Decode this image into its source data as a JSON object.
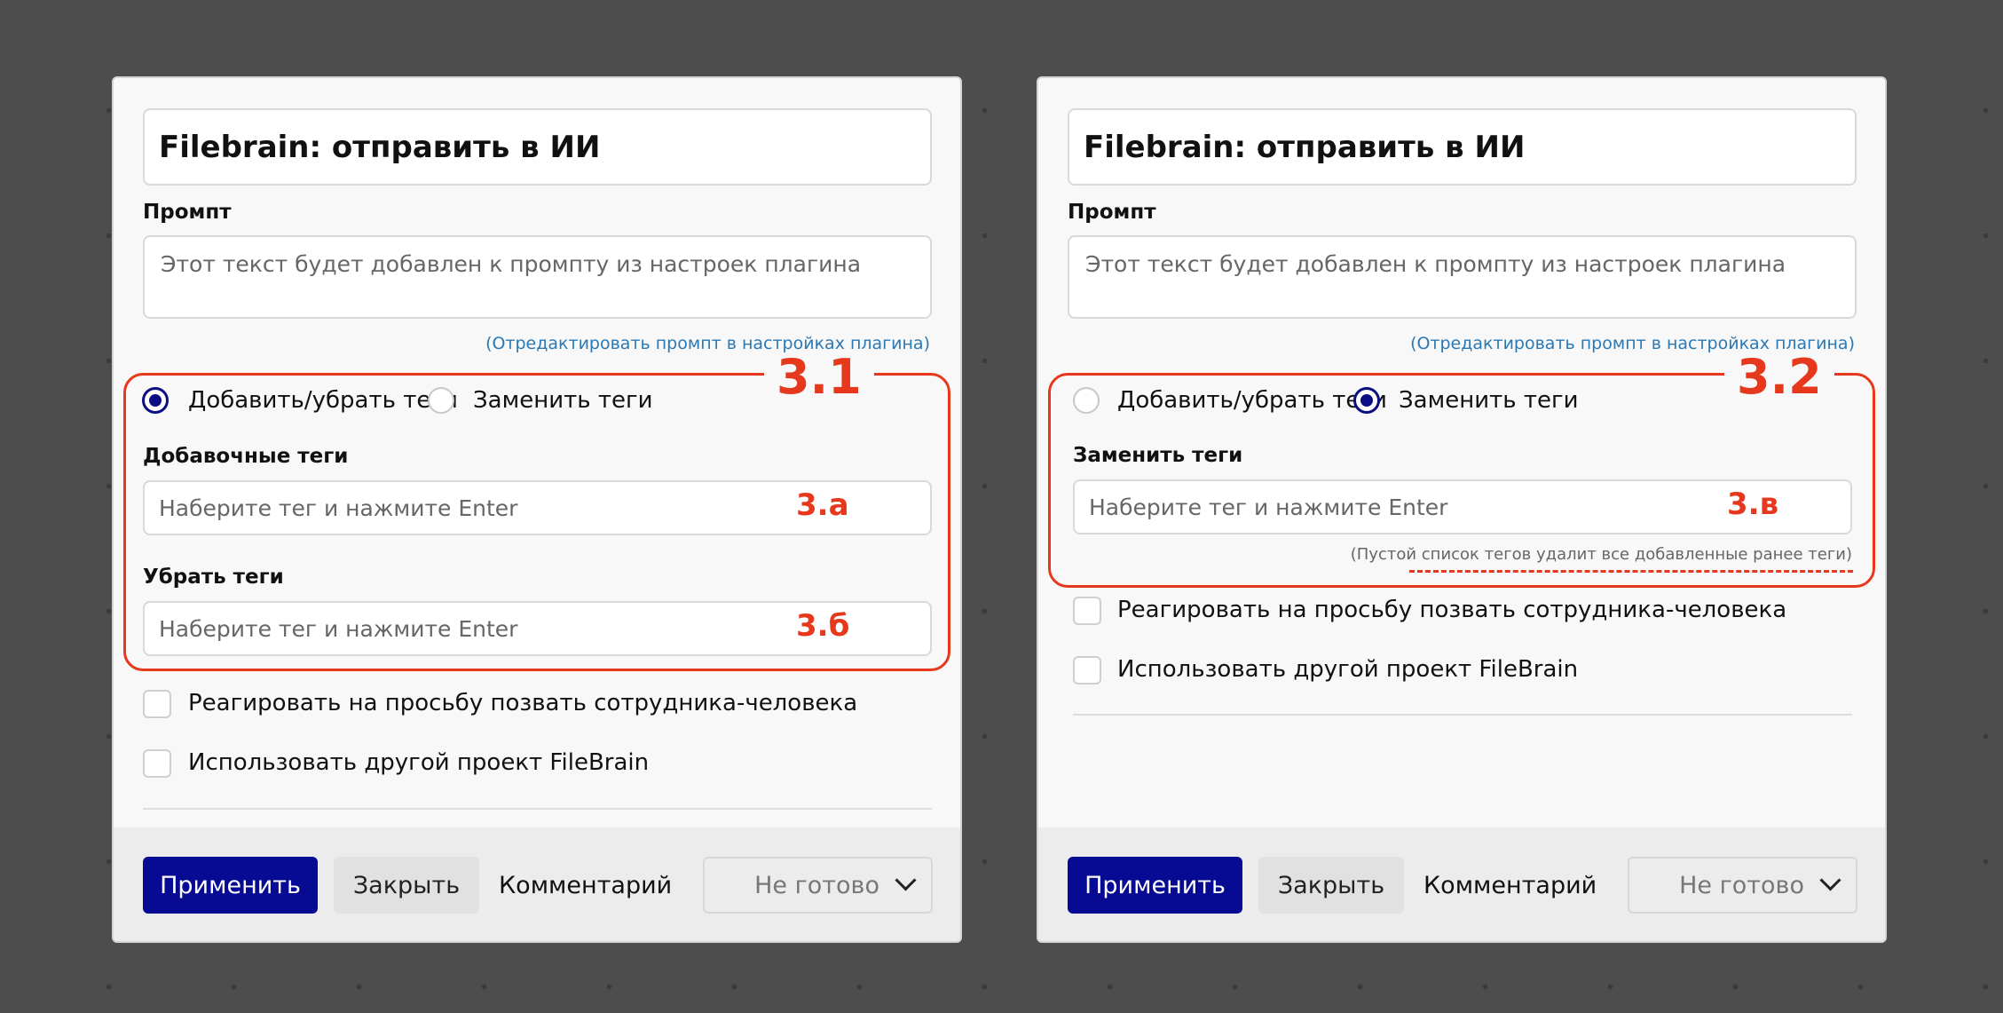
{
  "panel_left": {
    "title": "Filebrain: отправить в ИИ",
    "prompt_label": "Промпт",
    "prompt_placeholder": "Этот текст будет добавлен к промпту из настроек плагина",
    "edit_prompt_link": "(Отредактировать промпт в настройках плагина)",
    "annotation": "3.1",
    "radio_add_remove": "Добавить/убрать теги",
    "radio_replace": "Заменить теги",
    "selected_mode": "add_remove",
    "add_tags_label": "Добавочные теги",
    "add_tags_placeholder": "Наберите тег и нажмите Enter",
    "add_tags_code": "3.а",
    "remove_tags_label": "Убрать теги",
    "remove_tags_placeholder": "Наберите тег и нажмите Enter",
    "remove_tags_code": "3.б",
    "checkbox_human": "Реагировать на просьбу позвать сотрудника-человека",
    "checkbox_project": "Использовать другой проект FileBrain",
    "footer": {
      "apply": "Применить",
      "close": "Закрыть",
      "comment": "Комментарий",
      "status": "Не готово"
    }
  },
  "panel_right": {
    "title": "Filebrain: отправить в ИИ",
    "prompt_label": "Промпт",
    "prompt_placeholder": "Этот текст будет добавлен к промпту из настроек плагина",
    "edit_prompt_link": "(Отредактировать промпт в настройках плагина)",
    "annotation": "3.2",
    "radio_add_remove": "Добавить/убрать теги",
    "radio_replace": "Заменить теги",
    "selected_mode": "replace",
    "replace_tags_label": "Заменить теги",
    "replace_tags_placeholder": "Наберите тег и нажмите Enter",
    "replace_tags_code": "3.в",
    "replace_note": "(Пустой список тегов удалит все добавленные ранее теги)",
    "checkbox_human": "Реагировать на просьбу позвать сотрудника-человека",
    "checkbox_project": "Использовать другой проект FileBrain",
    "footer": {
      "apply": "Применить",
      "close": "Закрыть",
      "comment": "Комментарий",
      "status": "Не готово"
    }
  },
  "colors": {
    "accent": "#070a92",
    "annotation_red": "#e6381d",
    "link": "#2a79b5",
    "background": "#4d4d4d"
  }
}
